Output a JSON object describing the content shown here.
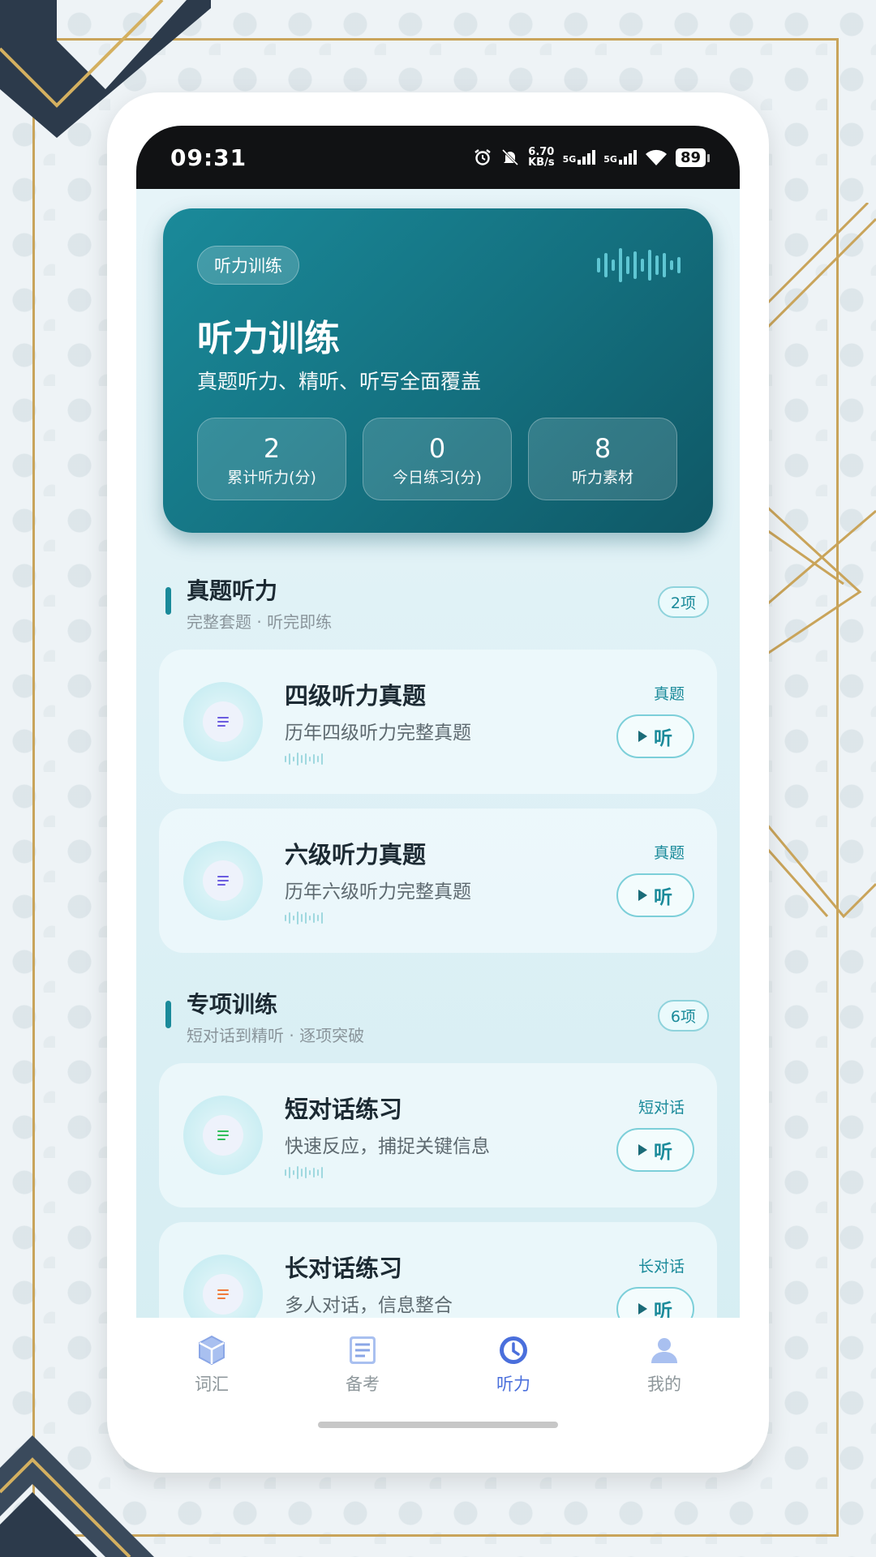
{
  "status_bar": {
    "time": "09:31",
    "speed": "6.70",
    "speed_unit": "KB/s",
    "net1": "5G",
    "net2": "5G",
    "battery": "89"
  },
  "hero": {
    "chip": "听力训练",
    "title": "听力训练",
    "subtitle": "真题听力、精听、听写全面覆盖",
    "stats": [
      {
        "value": "2",
        "label": "累计听力(分)"
      },
      {
        "value": "0",
        "label": "今日练习(分)"
      },
      {
        "value": "8",
        "label": "听力素材"
      }
    ]
  },
  "sections": [
    {
      "title": "真题听力",
      "subtitle": "完整套题 · 听完即练",
      "count": "2项",
      "items": [
        {
          "title": "四级听力真题",
          "desc": "历年四级听力完整真题",
          "tag": "真题",
          "button": "听",
          "accent": "#6a5be0"
        },
        {
          "title": "六级听力真题",
          "desc": "历年六级听力完整真题",
          "tag": "真题",
          "button": "听",
          "accent": "#6a5be0"
        }
      ]
    },
    {
      "title": "专项训练",
      "subtitle": "短对话到精听 · 逐项突破",
      "count": "6项",
      "items": [
        {
          "title": "短对话练习",
          "desc": "快速反应，捕捉关键信息",
          "tag": "短对话",
          "button": "听",
          "accent": "#2fbf5a"
        },
        {
          "title": "长对话练习",
          "desc": "多人对话，信息整合",
          "tag": "长对话",
          "button": "听",
          "accent": "#f07a3a"
        }
      ]
    }
  ],
  "tabbar": {
    "items": [
      {
        "label": "词汇",
        "icon": "cube-icon"
      },
      {
        "label": "备考",
        "icon": "document-icon"
      },
      {
        "label": "听力",
        "icon": "clock-icon",
        "active": true
      },
      {
        "label": "我的",
        "icon": "person-icon"
      }
    ]
  },
  "colors": {
    "accent": "#1a8a9a",
    "tab_active": "#4a6fdc"
  }
}
